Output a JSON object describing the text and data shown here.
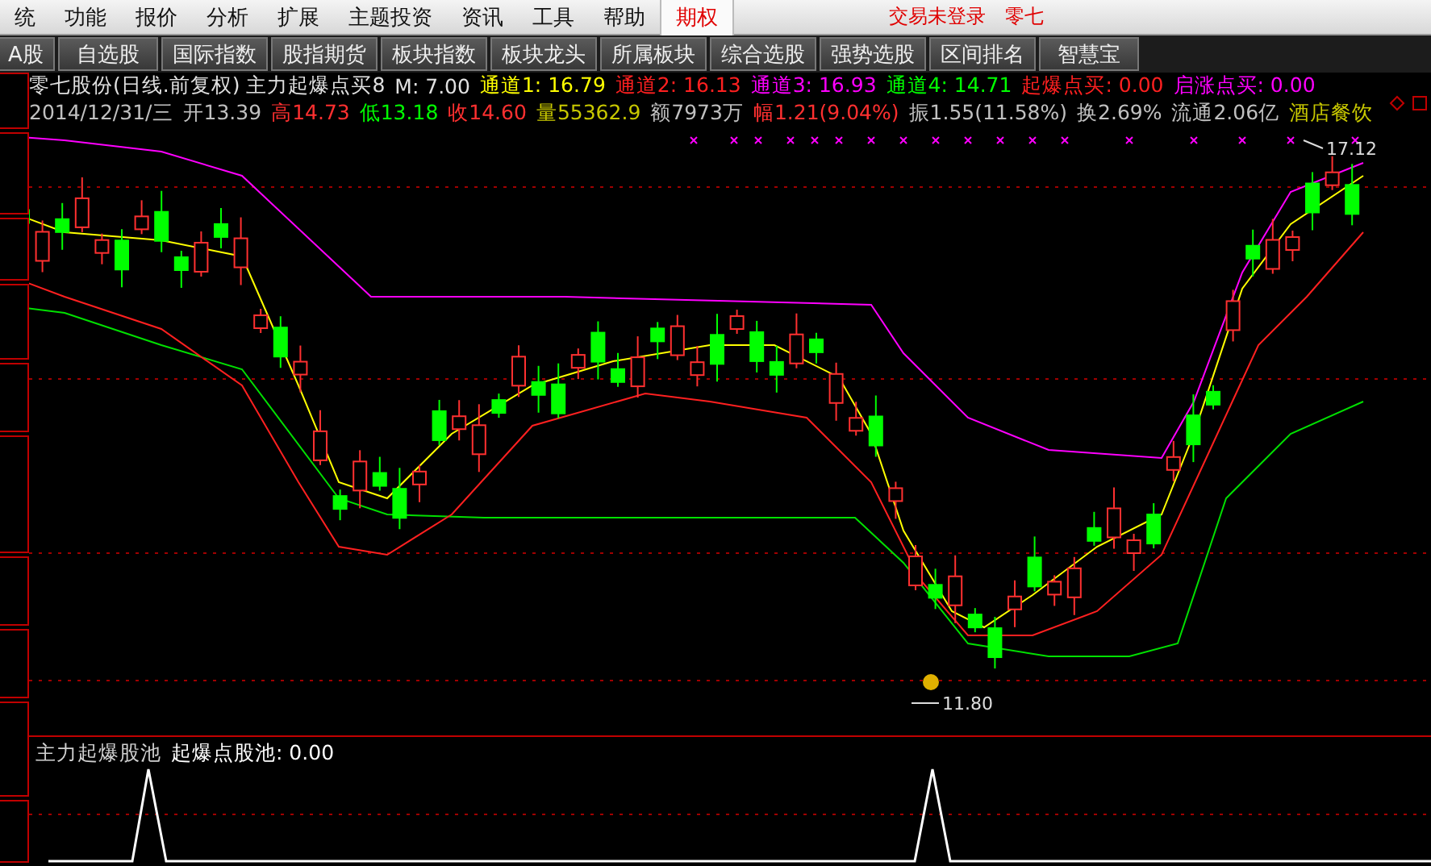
{
  "menu": {
    "items": [
      {
        "label": "统",
        "selected": false
      },
      {
        "label": "功能",
        "selected": false
      },
      {
        "label": "报价",
        "selected": false
      },
      {
        "label": "分析",
        "selected": false
      },
      {
        "label": "扩展",
        "selected": false
      },
      {
        "label": "主题投资",
        "selected": false
      },
      {
        "label": "资讯",
        "selected": false
      },
      {
        "label": "工具",
        "selected": false
      },
      {
        "label": "帮助",
        "selected": false
      },
      {
        "label": "期权",
        "selected": true
      }
    ],
    "status": [
      "交易未登录",
      "零七"
    ]
  },
  "toolbar": [
    "A股",
    "自选股",
    "国际指数",
    "股指期货",
    "板块指数",
    "板块龙头",
    "所属板块",
    "综合选股",
    "强势选股",
    "区间排名",
    "智慧宝"
  ],
  "quote_line": [
    {
      "text": "零七股份(日线.前复权) 主力起爆点买8",
      "color": "#e0e0e0"
    },
    {
      "text": "M: 7.00",
      "color": "#e0e0e0"
    },
    {
      "text": "通道1: 16.79",
      "color": "#ffff00"
    },
    {
      "text": "通道2: 16.13",
      "color": "#ff2020"
    },
    {
      "text": "通道3: 16.93",
      "color": "#ff00ff"
    },
    {
      "text": "通道4: 14.71",
      "color": "#00ff00"
    },
    {
      "text": "起爆点买: 0.00",
      "color": "#ff2020"
    },
    {
      "text": "启涨点买: 0.00",
      "color": "#ff00ff"
    }
  ],
  "data_line": [
    {
      "text": "2014/12/31/三",
      "color": "#c0c0c0"
    },
    {
      "text": "开13.39",
      "color": "#c0c0c0"
    },
    {
      "text": "高14.73",
      "color": "#ff3030"
    },
    {
      "text": "低13.18",
      "color": "#00ff00"
    },
    {
      "text": "收14.60",
      "color": "#ff3030"
    },
    {
      "text": "量55362.9",
      "color": "#c8c800"
    },
    {
      "text": "额7973万",
      "color": "#c0c0c0"
    },
    {
      "text": "幅1.21(9.04%)",
      "color": "#ff3030"
    },
    {
      "text": "振1.55(11.58%)",
      "color": "#c0c0c0"
    },
    {
      "text": "换2.69%",
      "color": "#c0c0c0"
    },
    {
      "text": "流通2.06亿",
      "color": "#c0c0c0"
    },
    {
      "text": "酒店餐饮",
      "color": "#c8c800"
    }
  ],
  "chart": {
    "high_label": "17.12",
    "low_label": "11.80"
  },
  "indicator": {
    "title": "主力起爆股池",
    "reading": "起爆点股池: 0.00"
  }
}
